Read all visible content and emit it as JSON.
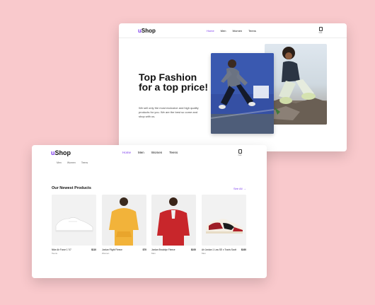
{
  "back_window": {
    "logo": {
      "prefix": "u",
      "rest": "Shop"
    },
    "nav": [
      {
        "label": "Home",
        "active": true
      },
      {
        "label": "Men",
        "active": false
      },
      {
        "label": "Women",
        "active": false
      },
      {
        "label": "Teens",
        "active": false
      }
    ],
    "cart_label": "Cart",
    "hero_title": "Top Fashion for a top price!",
    "hero_desc": "We sell only the most exclusive and high quality products for you. We are the best so come and shop with us."
  },
  "front_window": {
    "logo": {
      "prefix": "u",
      "rest": "Shop"
    },
    "nav": [
      {
        "label": "Home",
        "active": true
      },
      {
        "label": "Men",
        "active": false
      },
      {
        "label": "Women",
        "active": false
      },
      {
        "label": "Teens",
        "active": false
      }
    ],
    "cart_label": "Cart",
    "subnav": [
      "Men",
      "Women",
      "Teens"
    ],
    "section_title": "Our Newest Products",
    "see_all": "See All",
    "products": [
      {
        "name": "Nike Air Force 1 '07",
        "price": "$110",
        "category": "Teens",
        "image": "white-sneaker"
      },
      {
        "name": "Jordan Flight Fleece",
        "price": "$70",
        "category": "Women",
        "image": "yellow-hoodie"
      },
      {
        "name": "Jordan Brooklyn Fleece",
        "price": "$100",
        "category": "Men",
        "image": "red-sweatshirt"
      },
      {
        "name": "Air Jordan 1 Low SE x Travis Scott",
        "price": "$160",
        "category": "Men",
        "image": "red-black-sneaker"
      }
    ]
  },
  "colors": {
    "background": "#f9c9cc",
    "accent": "#7c3aed",
    "window": "#ffffff"
  }
}
